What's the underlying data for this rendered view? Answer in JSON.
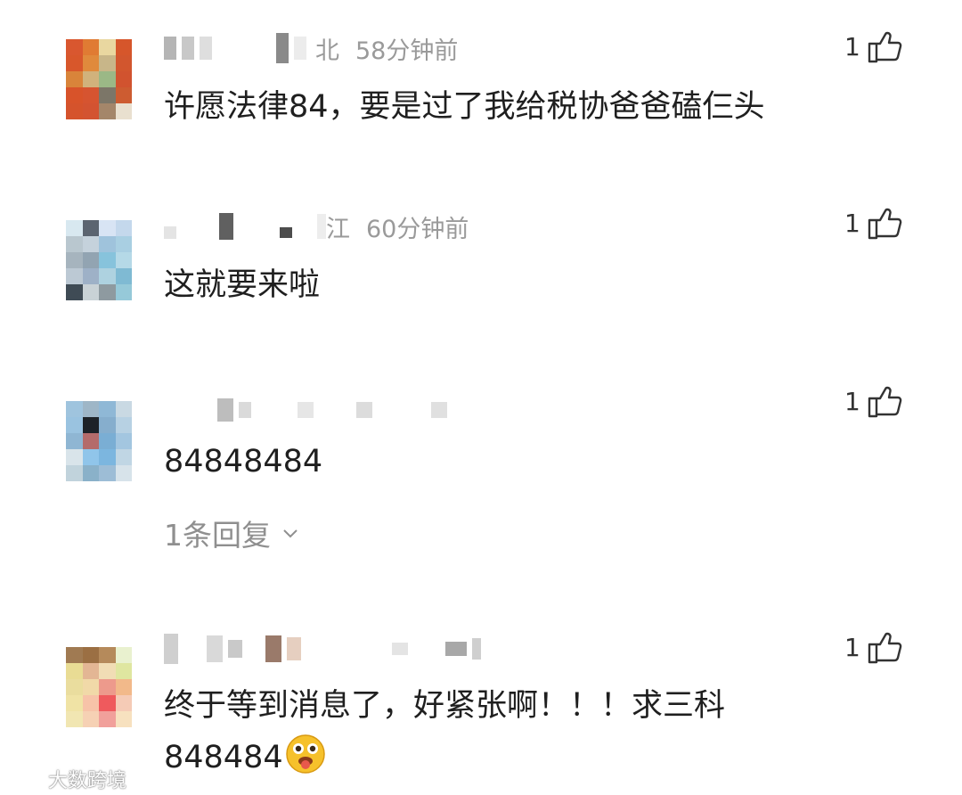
{
  "comments": [
    {
      "username_suffix": "北",
      "time": "58分钟前",
      "text": "许愿法律84，要是过了我给税协爸爸磕仨头",
      "likes": "1",
      "avatar_colors": [
        "#d9572f",
        "#e07b33",
        "#e9d7a0",
        "#d6562b",
        "#d8572b",
        "#e08a3c",
        "#c8b689",
        "#d2562e",
        "#d9843a",
        "#d1b27c",
        "#9bb886",
        "#d1532f",
        "#d8532a",
        "#d65430",
        "#7c7668",
        "#cd5c31",
        "#d5532c",
        "#d35331",
        "#a4866a",
        "#e9e0cf"
      ]
    },
    {
      "username_suffix": "江",
      "time": "60分钟前",
      "text": "这就要来啦",
      "likes": "1",
      "avatar_colors": [
        "#d8e8f0",
        "#5b6470",
        "#d8e4f4",
        "#c4d8ec",
        "#b9c7cf",
        "#c5d2dc",
        "#9fc3dc",
        "#a9cfe2",
        "#a6b4be",
        "#92a4b2",
        "#87c3dc",
        "#b5d9e7",
        "#bcc9d4",
        "#9eb1c7",
        "#aed2e0",
        "#7fbad3",
        "#3f4b55",
        "#c9d2d6",
        "#8e9aa0",
        "#96c9d9"
      ]
    },
    {
      "username_suffix": "",
      "time": "",
      "text": "84848484",
      "likes": "1",
      "replies_label": "1条回复",
      "avatar_colors": [
        "#9fc4de",
        "#9eb6c7",
        "#8fb8d6",
        "#c9d9e3",
        "#9ac3e0",
        "#1d2228",
        "#86aecd",
        "#b7d1e3",
        "#8fb6d3",
        "#b46b6b",
        "#7aaed4",
        "#a3c6e0",
        "#d9e4ea",
        "#90c5ea",
        "#7cb6df",
        "#c0d6e4",
        "#c1d3dc",
        "#8ab1c9",
        "#9dbdd6",
        "#d7e3ea"
      ]
    },
    {
      "username_suffix": "",
      "time": "",
      "text_line1": "终于等到消息了，好紧张啊！！！求三科",
      "text_line2": "848484",
      "likes": "1",
      "avatar_colors": [
        "#a07a52",
        "#9b6f43",
        "#b58a5b",
        "#e9f1cf",
        "#e9dc94",
        "#e3b694",
        "#f1ddb5",
        "#dfe6a0",
        "#eadd9e",
        "#f1d9a8",
        "#ed9a8c",
        "#f2b98a",
        "#f0e3a5",
        "#f7c3a8",
        "#ef5a5d",
        "#f5cbb6",
        "#f1e6b2",
        "#f6d1b4",
        "#f1a09b",
        "#f7e1bf"
      ]
    }
  ],
  "watermark": "大数跨境",
  "icons": {
    "like": "thumbs-up-icon",
    "chevron": "chevron-down-icon",
    "emoji": "tongue-face-emoji-icon",
    "logo": "watermark-logo-icon"
  }
}
